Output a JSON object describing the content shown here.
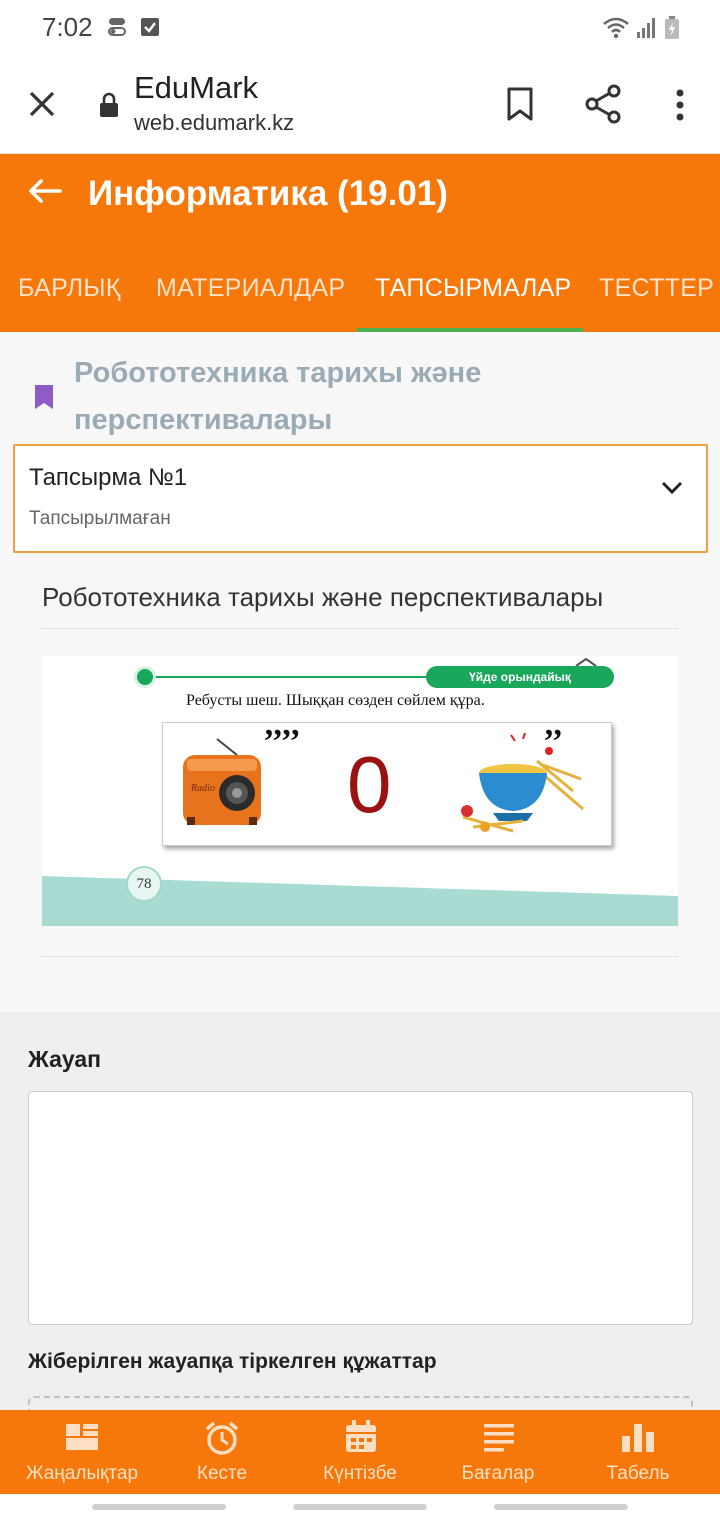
{
  "status_bar": {
    "time": "7:02"
  },
  "browser": {
    "site_title": "EduMark",
    "url": "web.edumark.kz"
  },
  "header": {
    "title": "Информатика (19.01)",
    "tabs": [
      {
        "label": "БАРЛЫҚ",
        "active": false
      },
      {
        "label": "МАТЕРИАЛДАР",
        "active": false
      },
      {
        "label": "ТАПСЫРМАЛАР",
        "active": true
      },
      {
        "label": "ТЕСТТЕР",
        "active": false
      }
    ]
  },
  "lesson": {
    "title": "Робототехника тарихы және перспективалары",
    "bookmark_color": "#8e5cc7"
  },
  "task": {
    "title": "Тапсырма №1",
    "status": "Тапсырылмаған"
  },
  "material": {
    "title": "Робототехника тарихы және перспективалары",
    "image": {
      "pill_text": "Үйде орындайық",
      "instruction": "Ребусты шеш. Шыққан сөзден сөйлем құра.",
      "commas_left": "’’’’",
      "center_symbol": "0",
      "commas_right": "’’",
      "radio_label": "Radio",
      "page_number": "78"
    }
  },
  "answer": {
    "label": "Жауап",
    "value": "",
    "attachments_label": "Жіберілген жауапқа тіркелген құжаттар"
  },
  "bottom_nav": [
    {
      "label": "Жаңалықтар",
      "icon": "news-grid-icon"
    },
    {
      "label": "Кесте",
      "icon": "alarm-clock-icon"
    },
    {
      "label": "Күнтізбе",
      "icon": "calendar-icon"
    },
    {
      "label": "Бағалар",
      "icon": "list-lines-icon"
    },
    {
      "label": "Табель",
      "icon": "bar-chart-icon"
    }
  ],
  "colors": {
    "brand_orange": "#f6780b",
    "tab_indicator": "#4caf50",
    "card_border": "#f0a040"
  }
}
